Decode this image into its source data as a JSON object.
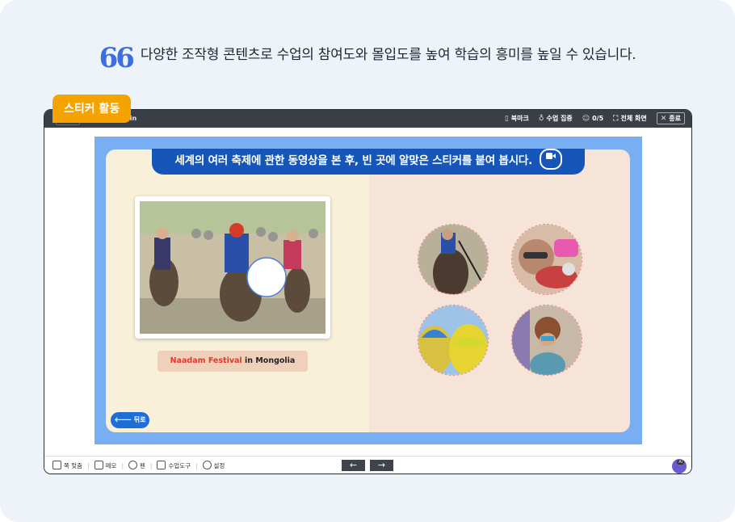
{
  "headline": {
    "quote_glyph": "66",
    "text": "다양한 조작형 콘텐츠로 수업의 참여도와 몰입도를 높여 학습의 흥미를 높일 수 있습니다."
  },
  "tag": {
    "label": "스티커 활동"
  },
  "topbar": {
    "title": "gin",
    "bookmark_label": "북마크",
    "focus_label": "수업 집중",
    "users_label": "0/5",
    "fullscreen_label": "전체 화면",
    "close_label": "종료"
  },
  "activity": {
    "instruction": "세계의 여러 축제에 관한 동영상을 본 후, 빈 곳에 알맞은 스티커를 붙여 봅시다.",
    "caption_highlight": "Naadam Festival",
    "caption_rest": " in Mongolia",
    "back_label": "뒤로",
    "stickers": [
      "horse-racing-sticker",
      "tomato-festival-sticker",
      "balloon-festival-sticker",
      "carnival-sticker"
    ]
  },
  "bottombar": {
    "items": [
      "쪽 맞춤",
      "메모",
      "펜",
      "수업도구",
      "설정"
    ],
    "prev_arrow": "←",
    "next_arrow": "→",
    "ai_badge": "AI"
  },
  "colors": {
    "accent_blue": "#1556b8",
    "tag_orange": "#f5a300",
    "stage_blue": "#7aaef2",
    "caption_red": "#e03a2c"
  }
}
